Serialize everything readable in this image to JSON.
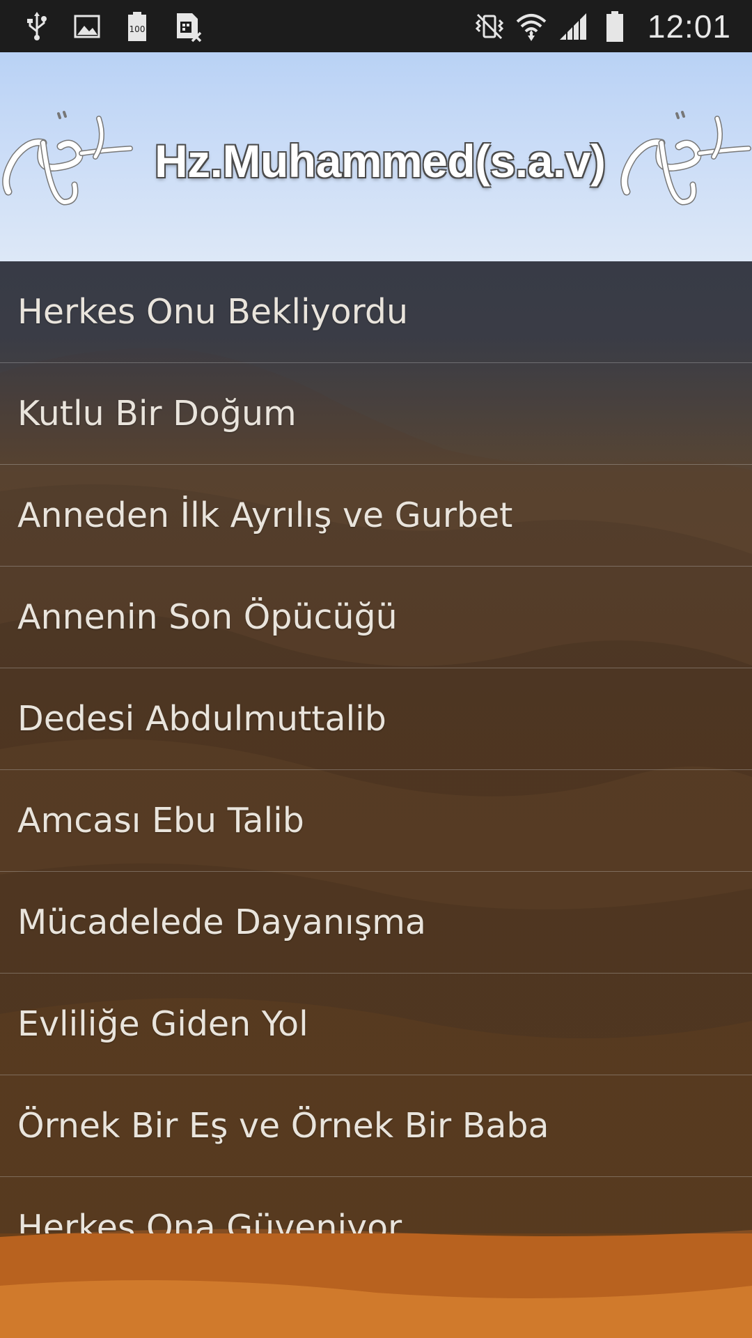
{
  "status_bar": {
    "time": "12:01",
    "icons": [
      "usb-icon",
      "image-icon",
      "battery-100-icon",
      "sim-error-icon",
      "vibrate-icon",
      "wifi-icon",
      "signal-icon",
      "battery-icon"
    ],
    "battery_badge": "100"
  },
  "banner": {
    "title": "Hz.Muhammed(s.a.v)",
    "colors": {
      "sky_top": "#b9d2f5",
      "sky_bottom": "#dde8f7"
    }
  },
  "list": {
    "items": [
      {
        "label": "Herkes Onu Bekliyordu"
      },
      {
        "label": "Kutlu Bir Doğum"
      },
      {
        "label": "Anneden İlk Ayrılış ve Gurbet"
      },
      {
        "label": "Annenin Son Öpücüğü"
      },
      {
        "label": "Dedesi Abdulmuttalib"
      },
      {
        "label": "Amcası Ebu Talib"
      },
      {
        "label": "Mücadelede Dayanışma"
      },
      {
        "label": "Evliliğe Giden Yol"
      },
      {
        "label": "Örnek Bir Eş ve Örnek Bir Baba"
      },
      {
        "label": "Herkes Ona Güveniyor"
      }
    ]
  }
}
